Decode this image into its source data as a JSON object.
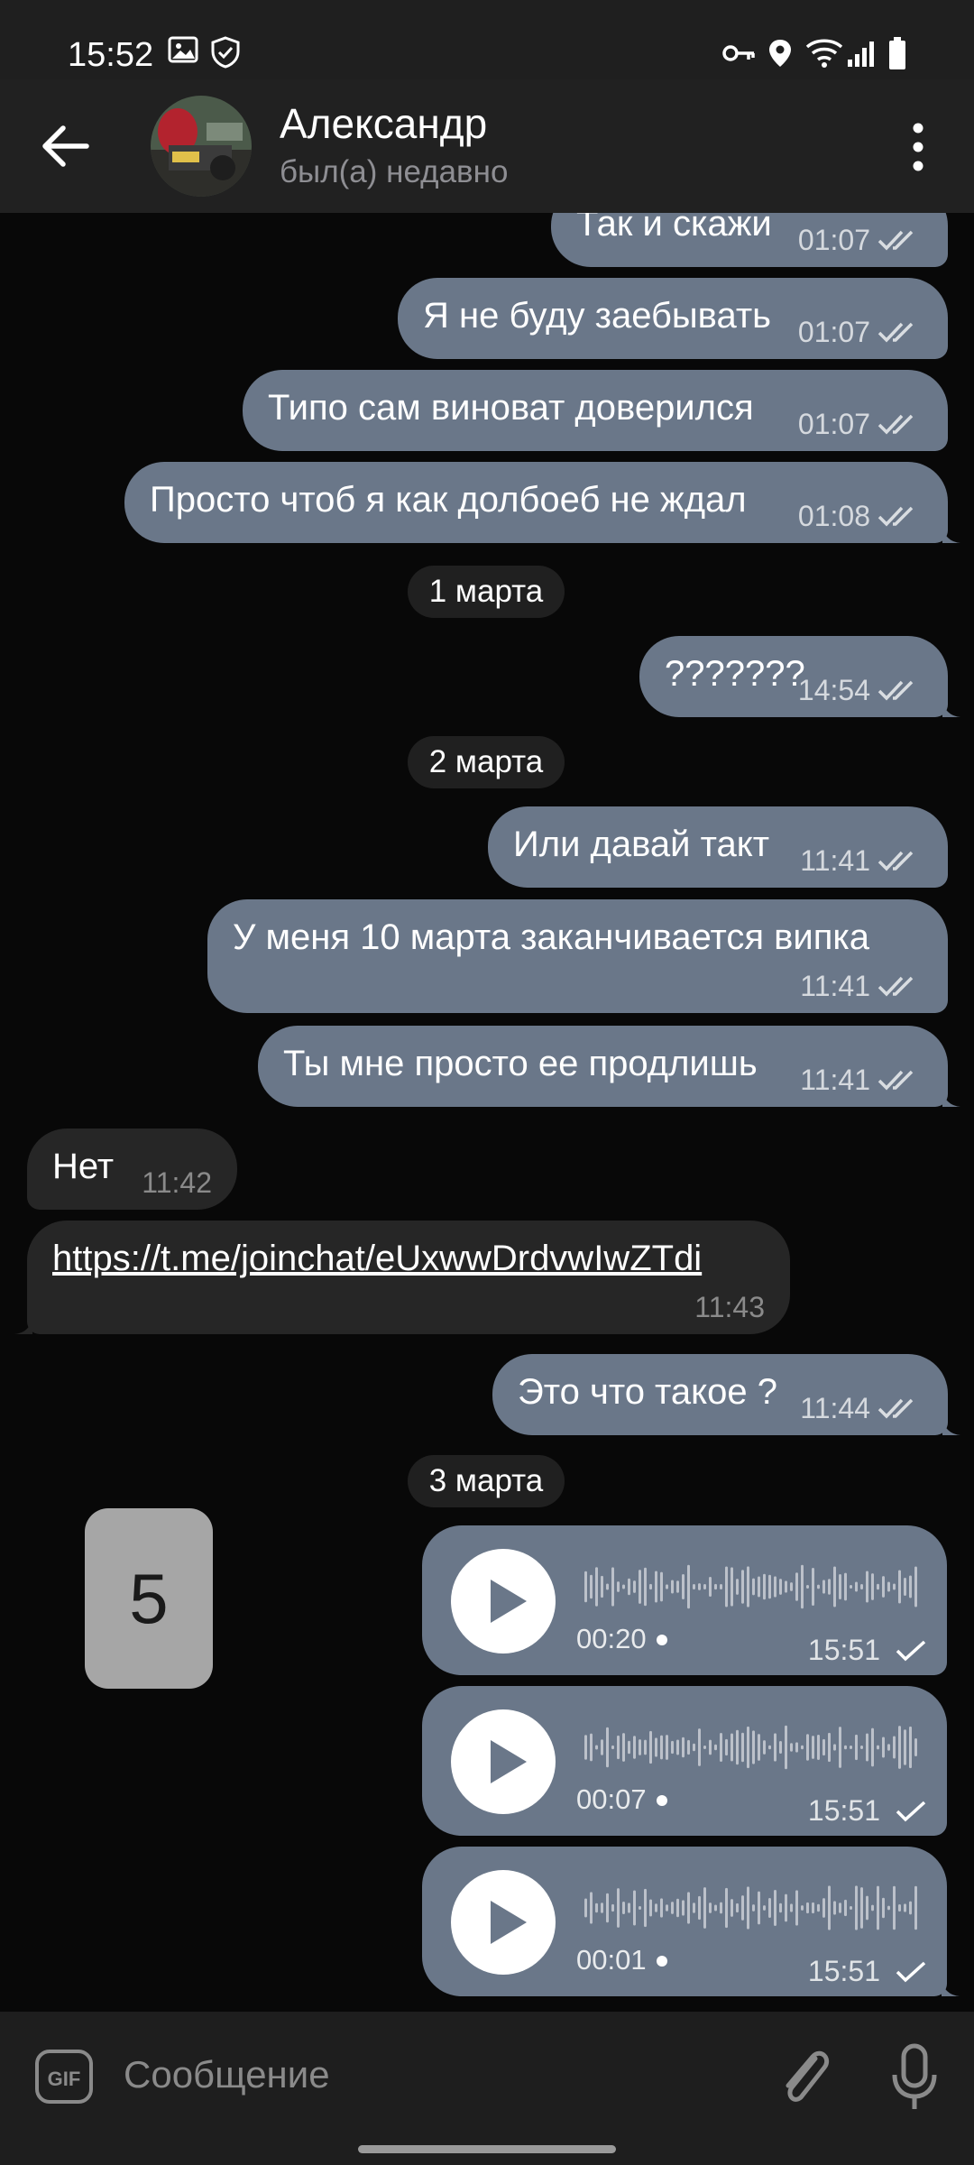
{
  "status_bar": {
    "time": "15:52"
  },
  "header": {
    "contact_name": "Александр",
    "contact_status": "был(а) недавно"
  },
  "messages": [
    {
      "text": "Так и скажи",
      "time": "01:07"
    },
    {
      "text": "Я не буду заебывать",
      "time": "01:07"
    },
    {
      "text": "Типо сам виноват доверился",
      "time": "01:07"
    },
    {
      "text": "Просто чтоб я как долбоеб не ждал",
      "time": "01:08"
    },
    {
      "text": "???????",
      "time": "14:54"
    },
    {
      "text": "Или давай такт",
      "time": "11:41"
    },
    {
      "text": "У меня 10 марта заканчивается випка",
      "time": "11:41"
    },
    {
      "text": "Ты мне просто ее продлишь",
      "time": "11:41"
    },
    {
      "text": "Нет",
      "time": "11:42"
    },
    {
      "text": "https://t.me/joinchat/eUxwwDrdvwIwZTdi",
      "time": "11:43"
    },
    {
      "text": "Это что такое ?",
      "time": "11:44"
    }
  ],
  "date_separators": [
    "1 марта",
    "2 марта",
    "3 марта"
  ],
  "sticker": {
    "text": "5"
  },
  "voice_messages": [
    {
      "duration": "00:20",
      "time": "15:51"
    },
    {
      "duration": "00:07",
      "time": "15:51"
    },
    {
      "duration": "00:01",
      "time": "15:51"
    }
  ],
  "input": {
    "placeholder": "Сообщение",
    "gif_label": "GIF"
  },
  "colors": {
    "outgoing_bubble": "#6a7789",
    "incoming_bubble": "#262626",
    "background": "#080808",
    "link": "#9fb6cb"
  },
  "icons": [
    "back-arrow-icon",
    "more-vert-icon",
    "gif-icon",
    "paperclip-icon",
    "microphone-icon",
    "play-icon",
    "double-check-icon",
    "single-check-icon"
  ]
}
